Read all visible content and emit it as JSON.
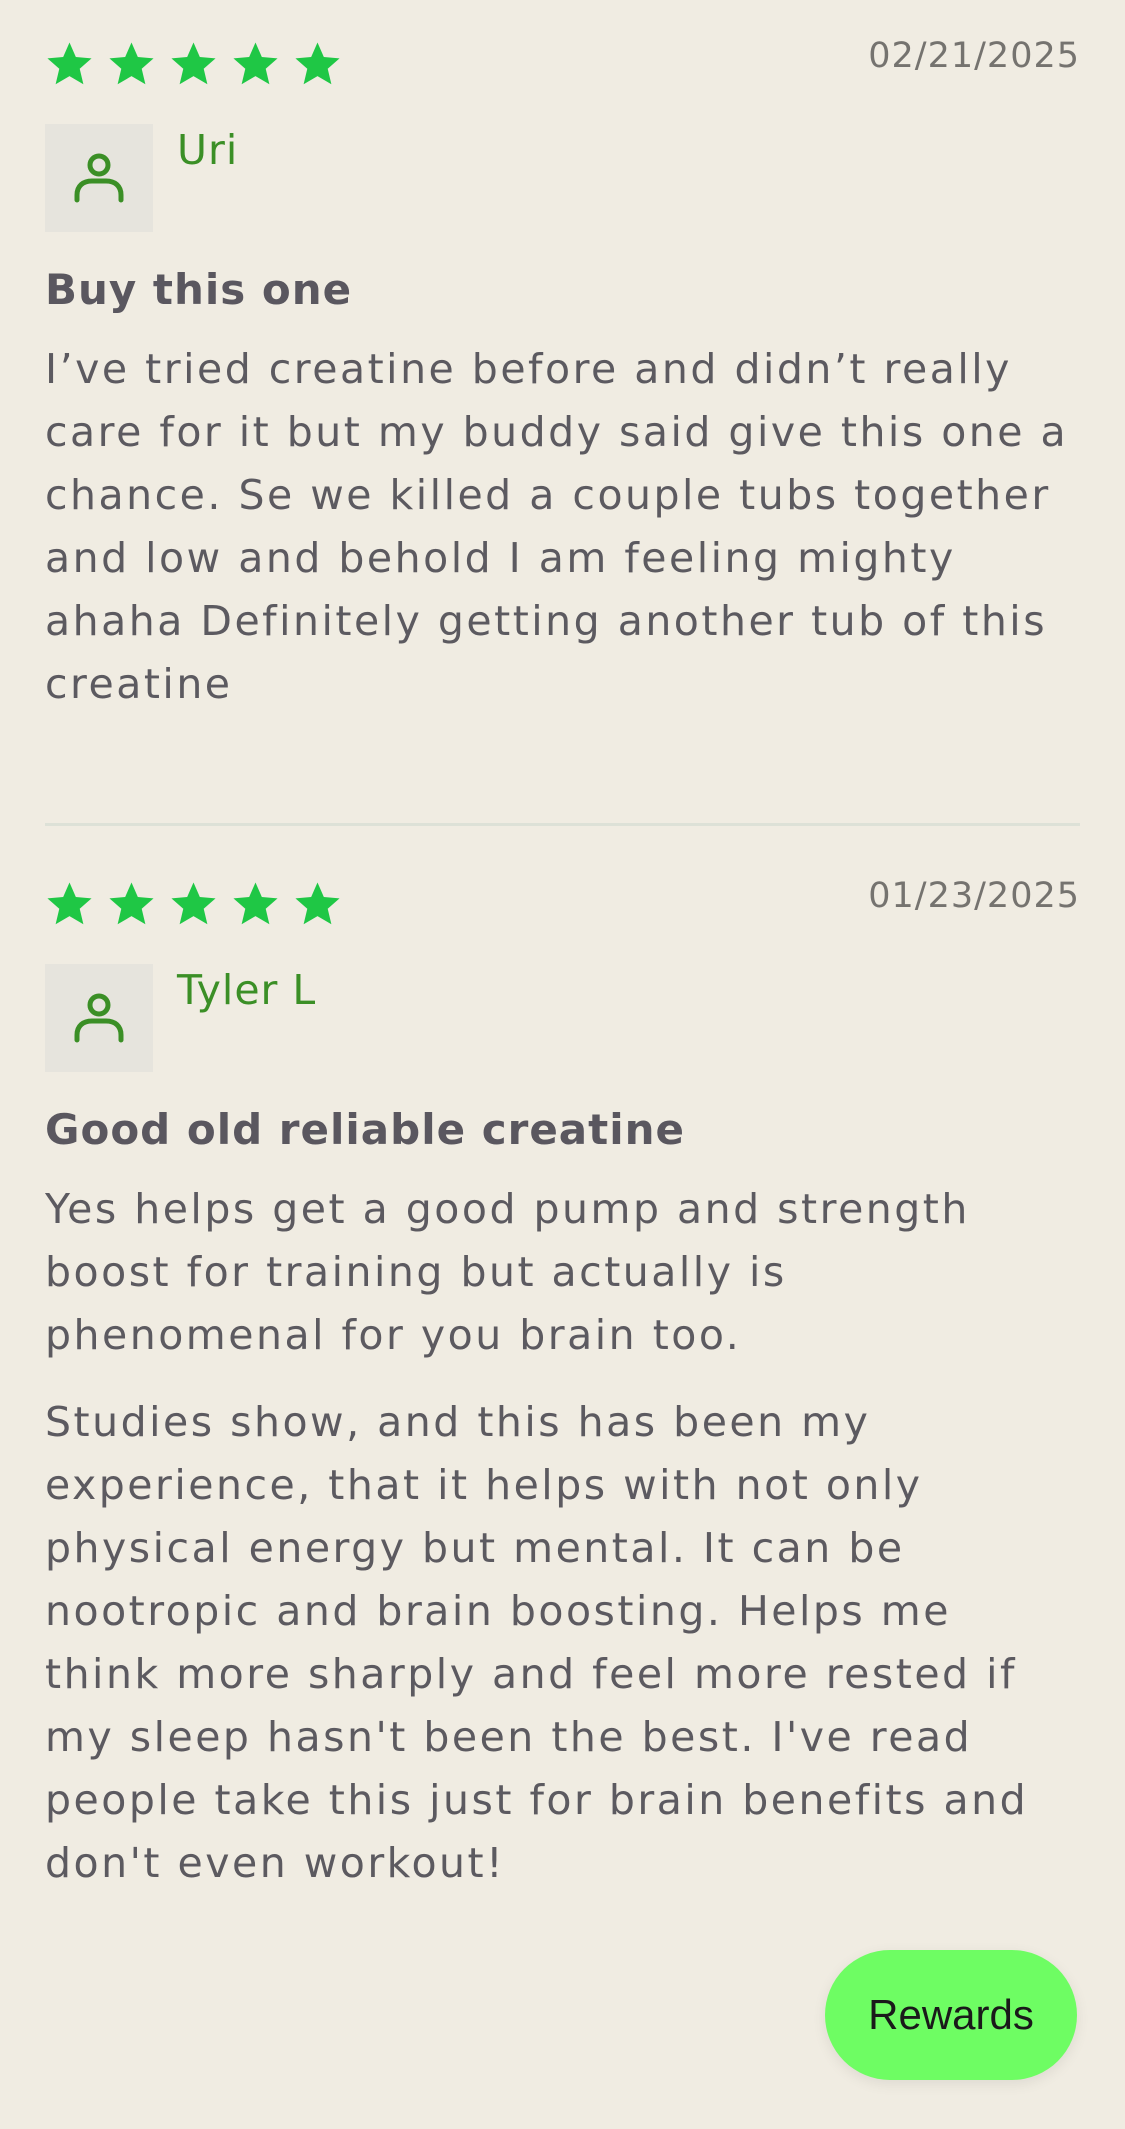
{
  "colors": {
    "background": "#f0ece2",
    "star": "#1fc745",
    "author_name": "#3b8f26",
    "rewards_button": "#6efd63"
  },
  "reviews": [
    {
      "rating": 5,
      "date": "02/21/2025",
      "author": "Uri",
      "avatar_icon": "user-icon",
      "title": "Buy this one",
      "paragraphs": [
        "I’ve tried creatine before and didn’t really care for it but my buddy said give this one a chance. Se we killed a couple tubs together and low and behold I am feeling mighty ahaha Definitely getting another tub of this creatine"
      ]
    },
    {
      "rating": 5,
      "date": "01/23/2025",
      "author": "Tyler L",
      "avatar_icon": "user-icon",
      "title": "Good old reliable creatine",
      "paragraphs": [
        "Yes helps get a good pump and strength boost for training but actually is phenomenal for you brain too.",
        "Studies show, and this has been my experience, that it helps with not only physical energy but mental. It can be nootropic and brain boosting. Helps me think more sharply and feel more rested if my sleep hasn't been the best. I've read people take this just for brain benefits and don't even workout!"
      ]
    }
  ],
  "rewards_button": {
    "label": "Rewards"
  }
}
